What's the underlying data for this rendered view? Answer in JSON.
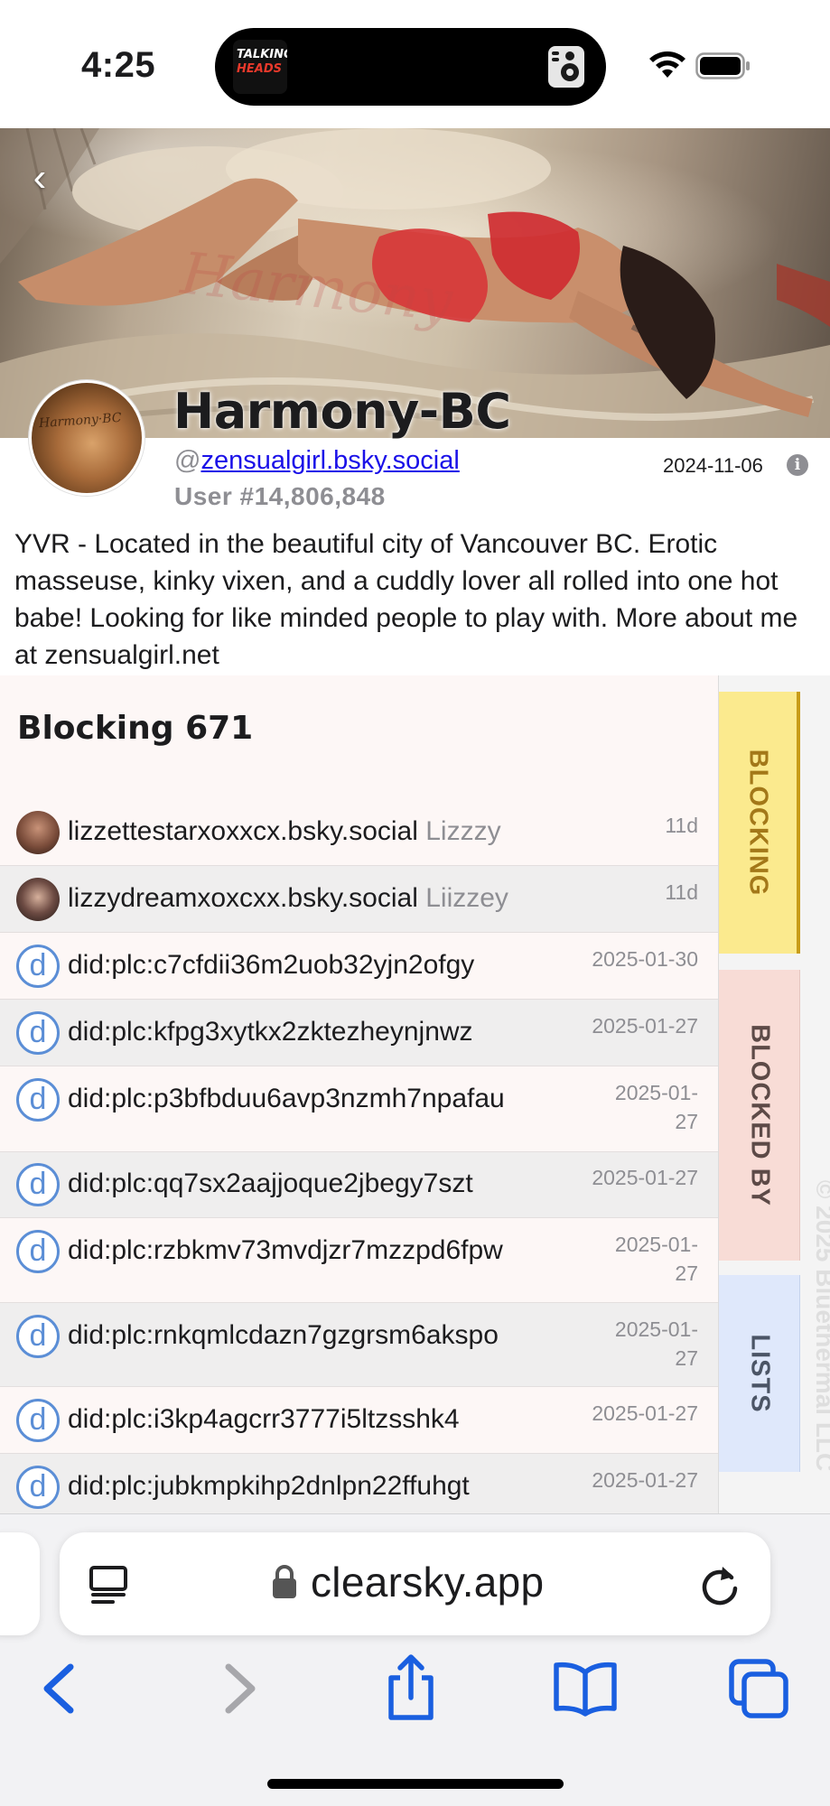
{
  "status_bar": {
    "time": "4:25",
    "island_album_line1": "TALKING",
    "island_album_line2": "HEADS",
    "icons": [
      "speaker-icon",
      "wifi-icon",
      "battery-icon"
    ]
  },
  "banner": {
    "watermark": "Harmony",
    "back_label": "‹"
  },
  "profile": {
    "avatar_signature": "Harmony·BC",
    "display_name": "Harmony-BC",
    "handle_prefix": "@",
    "handle": "zensualgirl.bsky.social",
    "user_number": "User #14,806,848",
    "join_date": "2024-11-06",
    "bio": "YVR - Located in the beautiful city of Vancouver BC. Erotic masseuse, kinky vixen, and a cuddly lover all rolled into one hot babe! Looking for like minded people to play with. More about me at zensualgirl.net"
  },
  "blocking": {
    "title": "Blocking 671",
    "rows": [
      {
        "handle": "lizzettestarxoxxcx.bsky.social",
        "nickname": "Lizzzy",
        "date": "11d",
        "icon": "avatar"
      },
      {
        "handle": "lizzydreamxoxcxx.bsky.social",
        "nickname": "Liizzey",
        "date": "11d",
        "icon": "avatar"
      },
      {
        "handle": "did:plc:c7cfdii36m2uob32yjn2ofgy",
        "nickname": "",
        "date": "2025-01-30",
        "icon": "did-icon"
      },
      {
        "handle": "did:plc:kfpg3xytkx2zktezheynjnwz",
        "nickname": "",
        "date": "2025-01-27",
        "icon": "did-icon"
      },
      {
        "handle": "did:plc:p3bfbduu6avp3nzmh7npafau",
        "nickname": "",
        "date_line1": "2025-01-",
        "date_line2": "27",
        "icon": "did-icon"
      },
      {
        "handle": "did:plc:qq7sx2aajjoque2jbegy7szt",
        "nickname": "",
        "date": "2025-01-27",
        "icon": "did-icon"
      },
      {
        "handle": "did:plc:rzbkmv73mvdjzr7mzzpd6fpw",
        "nickname": "",
        "date_line1": "2025-01-",
        "date_line2": "27",
        "icon": "did-icon"
      },
      {
        "handle": "did:plc:rnkqmlcdazn7gzgrsm6akspo",
        "nickname": "",
        "date_line1": "2025-01-",
        "date_line2": "27",
        "icon": "did-icon"
      },
      {
        "handle": "did:plc:i3kp4agcrr3777i5ltzsshk4",
        "nickname": "",
        "date": "2025-01-27",
        "icon": "did-icon"
      },
      {
        "handle": "did:plc:jubkmpkihp2dnlpn22ffuhgt",
        "nickname": "",
        "date": "2025-01-27",
        "icon": "did-icon"
      }
    ],
    "did_letter": "d"
  },
  "side_tabs": {
    "blocking": "BLOCKING",
    "blocked_by": "BLOCKED BY",
    "lists": "LISTS",
    "copyright": "© 2025 Bluethermal LLC",
    "colors": {
      "blocking": "#fbea8e",
      "blocked_by": "#f8dcd6",
      "lists": "#dfe8fb"
    }
  },
  "browser": {
    "url": "clearsky.app",
    "icons": [
      "reader-icon",
      "lock-icon",
      "reload-icon",
      "back-arrow-icon",
      "forward-arrow-icon",
      "share-icon",
      "bookmarks-icon",
      "tabs-icon"
    ],
    "accent_color": "#1a5fe0"
  }
}
